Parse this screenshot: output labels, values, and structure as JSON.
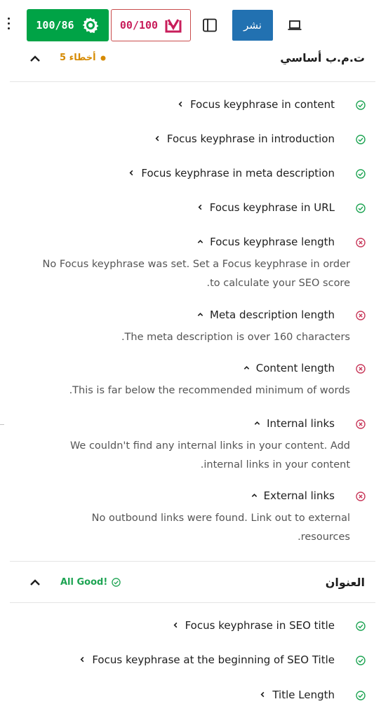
{
  "toolbar": {
    "seo_score": "100/86",
    "readability_score": "00/100",
    "publish_label": "نشر"
  },
  "basic_seo": {
    "title": "ت.م.ب أساسي",
    "status": "5 أخطاء",
    "items": [
      {
        "label": "Focus keyphrase in content",
        "state": "good"
      },
      {
        "label": "Focus keyphrase in introduction",
        "state": "good"
      },
      {
        "label": "Focus keyphrase in meta description",
        "state": "good"
      },
      {
        "label": "Focus keyphrase in URL",
        "state": "good"
      },
      {
        "label": "Focus keyphrase length",
        "state": "problem",
        "description": [
          "No Focus keyphrase was set. Set a Focus keyphrase in order",
          ".to calculate your SEO score"
        ]
      },
      {
        "label": "Meta description length",
        "state": "problem",
        "description": [
          ".The meta description is over 160 characters"
        ]
      },
      {
        "label": "Content length",
        "state": "problem",
        "description": [
          ".This is far below the recommended minimum of words"
        ]
      },
      {
        "label": "Internal links",
        "state": "problem",
        "description": [
          "We couldn't find any internal links in your content. Add",
          ".internal links in your content"
        ]
      },
      {
        "label": "External links",
        "state": "problem",
        "description": [
          "No outbound links were found. Link out to external",
          ".resources"
        ]
      }
    ]
  },
  "title_section": {
    "title": "العنوان",
    "status": "All Good!",
    "items": [
      {
        "label": "Focus keyphrase in SEO title",
        "state": "good"
      },
      {
        "label": "Focus keyphrase at the beginning of SEO Title",
        "state": "good"
      },
      {
        "label": "Title Length",
        "state": "good"
      }
    ]
  },
  "colors": {
    "good": "#1ea453",
    "problem": "#c8385a",
    "warning": "#d68a00",
    "publish": "#2271b1"
  }
}
